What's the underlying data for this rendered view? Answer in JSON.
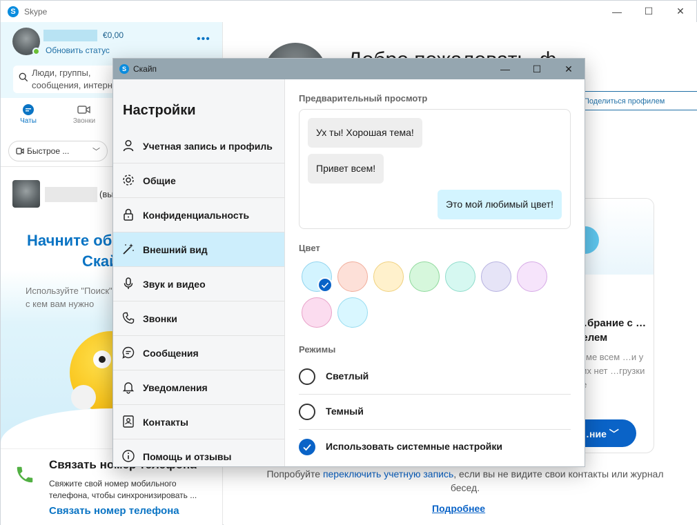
{
  "main_window": {
    "title": "Skype",
    "logo_letter": "S",
    "controls": {
      "minimize": "—",
      "maximize": "☐",
      "close": "✕"
    }
  },
  "profile": {
    "balance": "€0,00",
    "update_status": "Обновить статус",
    "more": "•••"
  },
  "search": {
    "placeholder": "Люди, группы, сообщения, интернет"
  },
  "nav_tabs": {
    "chats": "Чаты",
    "calls": "Звонки"
  },
  "quick_button": {
    "label": "Быстрое ..."
  },
  "contact": {
    "suffix": "(вы)"
  },
  "welcome": {
    "title_line1": "Начните общение в",
    "title_line2": "Скайпе",
    "subtitle": "Используйте \"Поиск\", чтобы найти людей, с кем вам нужно"
  },
  "banner": {
    "title": "Связать номер телефона",
    "close": "✕",
    "text": "Свяжите свой номер мобильного телефона, чтобы синхронизировать ...",
    "link": "Связать номер телефона"
  },
  "right_pane": {
    "heading": "Добро пожаловать, ф",
    "share_profile": "Поделиться профилем",
    "card_title": "…брание с …телем",
    "card_text": "…ме всем …и у них нет …грузки не",
    "card_button": "…ние",
    "try_prefix": "Попробуйте ",
    "try_link": "переключить учетную запись",
    "try_suffix": ", если вы не видите свои контакты или журнал бесед.",
    "more_link": "Подробнее"
  },
  "dialog": {
    "title": "Скайп",
    "logo_letter": "S",
    "controls": {
      "minimize": "—",
      "maximize": "☐",
      "close": "✕"
    },
    "heading": "Настройки",
    "menu": [
      {
        "label": "Учетная запись и профиль",
        "icon": "user-icon"
      },
      {
        "label": "Общие",
        "icon": "gear-icon"
      },
      {
        "label": "Конфиденциальность",
        "icon": "lock-icon"
      },
      {
        "label": "Внешний вид",
        "icon": "magic-wand-icon"
      },
      {
        "label": "Звук и видео",
        "icon": "microphone-icon"
      },
      {
        "label": "Звонки",
        "icon": "phone-icon"
      },
      {
        "label": "Сообщения",
        "icon": "chat-bubble-icon"
      },
      {
        "label": "Уведомления",
        "icon": "bell-icon"
      },
      {
        "label": "Контакты",
        "icon": "contact-card-icon"
      },
      {
        "label": "Помощь и отзывы",
        "icon": "info-icon"
      }
    ],
    "active_menu": "Внешний вид",
    "preview": {
      "label": "Предварительный просмотр",
      "messages": [
        {
          "text": "Ух ты! Хорошая тема!",
          "direction": "incoming"
        },
        {
          "text": "Привет всем!",
          "direction": "incoming"
        },
        {
          "text": "Это мой любимый цвет!",
          "direction": "outgoing"
        }
      ]
    },
    "color": {
      "label": "Цвет",
      "swatches": [
        {
          "fill": "#d3f4ff",
          "border": "#8fd3ee",
          "selected": true
        },
        {
          "fill": "#fde0d8",
          "border": "#f1ad9b",
          "selected": false
        },
        {
          "fill": "#fff1cc",
          "border": "#f0d17e",
          "selected": false
        },
        {
          "fill": "#d6f7dc",
          "border": "#8fd99c",
          "selected": false
        },
        {
          "fill": "#d6f8f1",
          "border": "#8fdccb",
          "selected": false
        },
        {
          "fill": "#e6e4f7",
          "border": "#b6b1e0",
          "selected": false
        },
        {
          "fill": "#f6e4fb",
          "border": "#d6a9e6",
          "selected": false
        },
        {
          "fill": "#fbdcef",
          "border": "#e8a0c8",
          "selected": false
        },
        {
          "fill": "#d9f7ff",
          "border": "#96dcf0",
          "selected": false
        }
      ]
    },
    "modes": {
      "label": "Режимы",
      "options": [
        {
          "label": "Светлый",
          "checked": false
        },
        {
          "label": "Темный",
          "checked": false
        },
        {
          "label": "Использовать системные настройки",
          "checked": true
        }
      ]
    }
  },
  "colors": {
    "accent": "#0a63c7",
    "skype_blue": "#0a8cde",
    "active_menu_bg": "#cdeefc",
    "dialog_titlebar": "#95a6b0"
  }
}
